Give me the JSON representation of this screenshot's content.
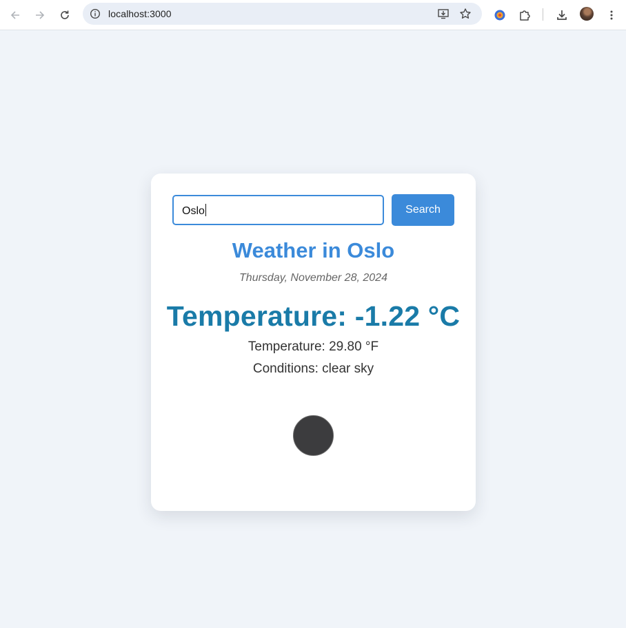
{
  "browser": {
    "url": "localhost:3000"
  },
  "search": {
    "value": "Oslo",
    "button_label": "Search"
  },
  "weather": {
    "title": "Weather in Oslo",
    "date": "Thursday, November 28, 2024",
    "temperature_c": "Temperature: -1.22 °C",
    "temperature_f": "Temperature: 29.80 °F",
    "conditions": "Conditions: clear sky",
    "icon": "clear-sky-icon"
  },
  "colors": {
    "accent": "#3b8ada",
    "temperature": "#1a7ba8",
    "page_background": "#f0f4f9"
  }
}
